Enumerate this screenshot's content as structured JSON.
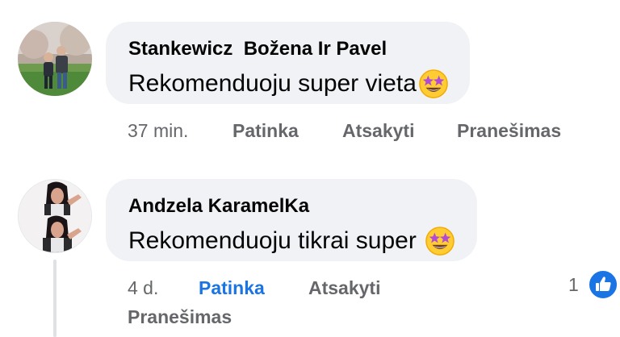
{
  "comments": [
    {
      "author": "Stankewicz  Božena Ir Pavel",
      "text": "Rekomenduoju super vieta",
      "emoji_icon": "star-struck-emoji",
      "time": "37 min.",
      "like_label": "Patinka",
      "reply_label": "Atsakyti",
      "report_label": "Pranešimas"
    },
    {
      "author": "Andzela KaramelKa",
      "text": "Rekomenduoju tikrai super",
      "emoji_icon": "star-struck-emoji",
      "time": "4 d.",
      "like_label": "Patinka",
      "reply_label": "Atsakyti",
      "report_label": "Pranešimas",
      "reaction_count": "1",
      "reaction_icon": "like-thumbs-up-icon"
    }
  ],
  "colors": {
    "bubble": "#f0f2f5",
    "muted_text": "#65676b",
    "accent_blue": "#1b74e4"
  }
}
